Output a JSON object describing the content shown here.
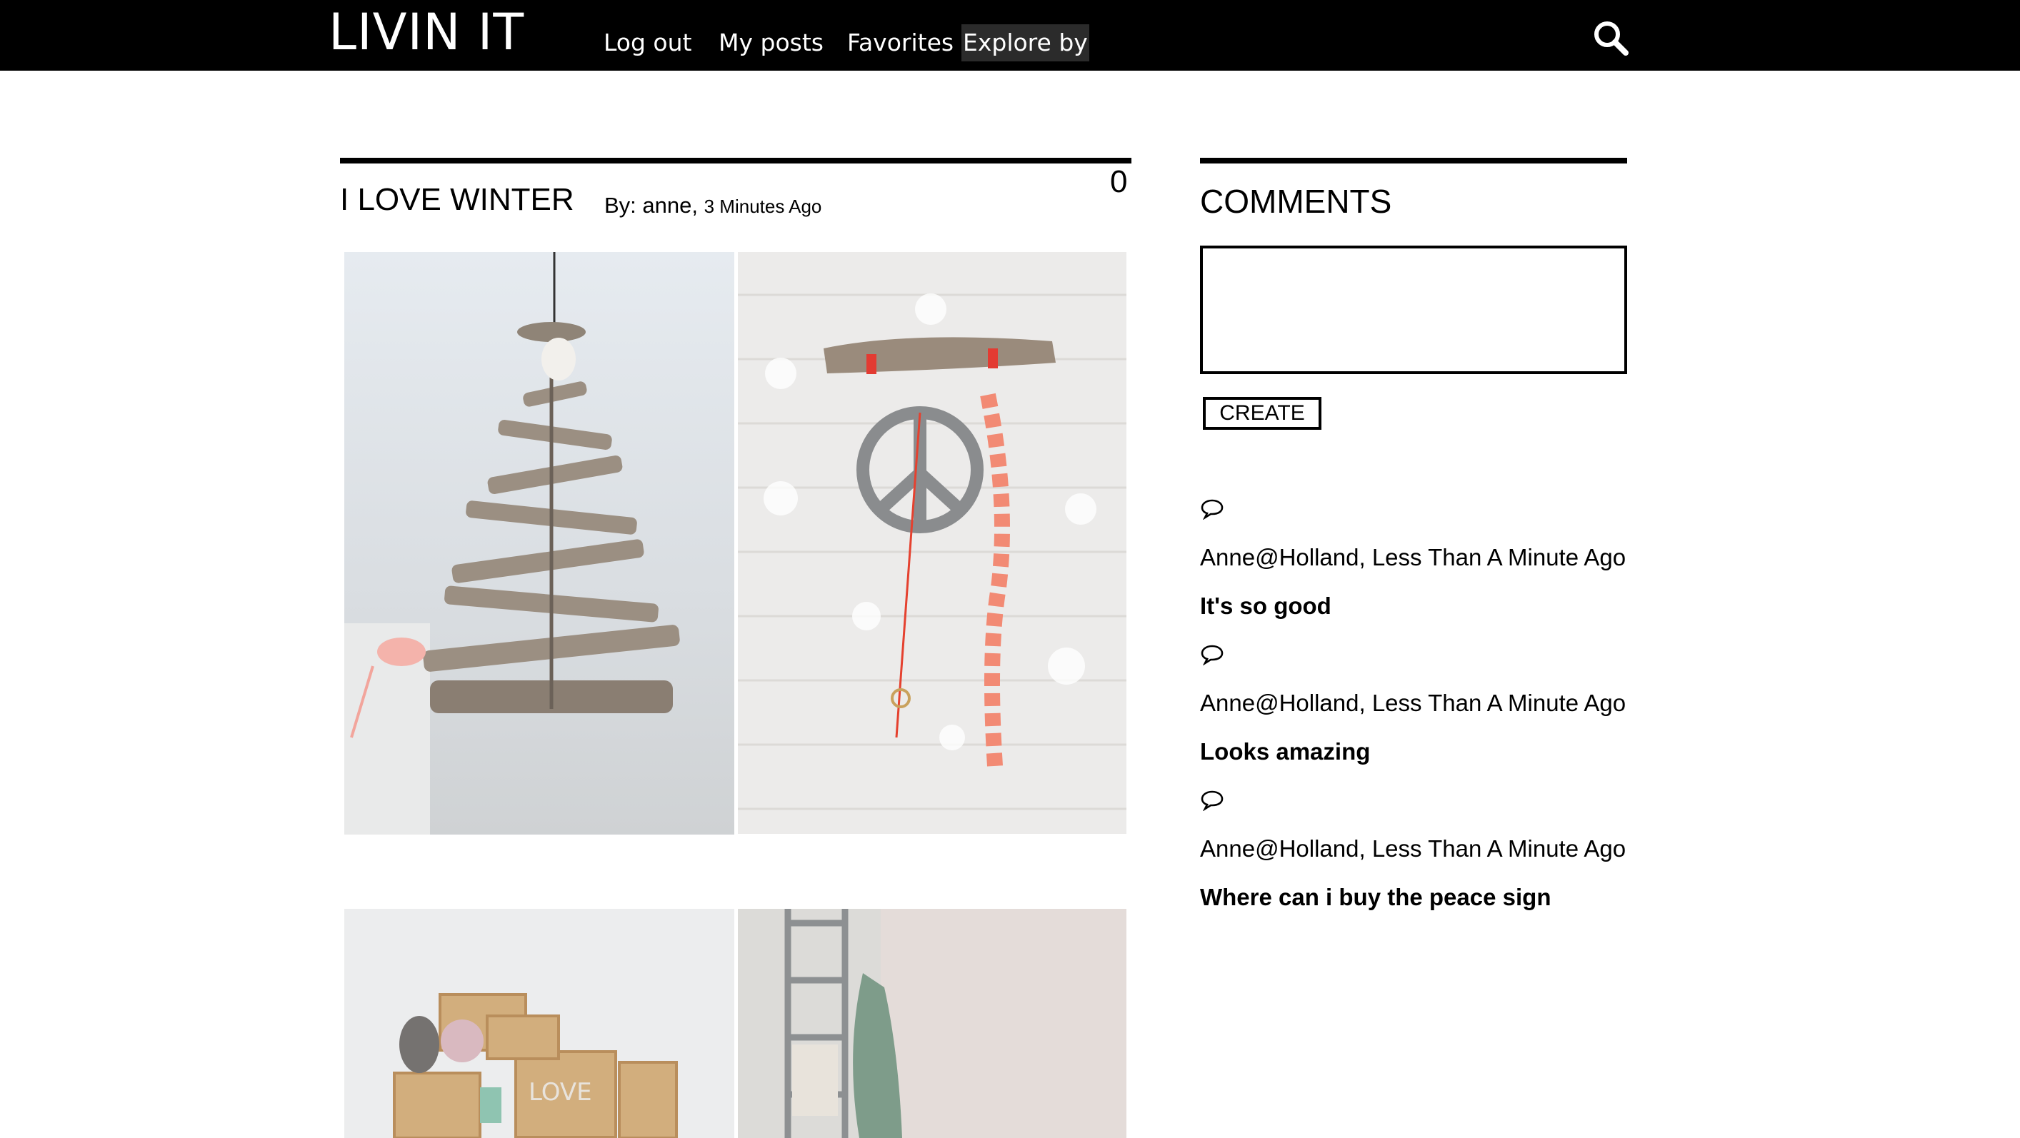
{
  "app": {
    "logo": "LIVIN IT"
  },
  "nav": {
    "items": [
      {
        "label": "Log out"
      },
      {
        "label": "My posts"
      },
      {
        "label": "Favorites"
      },
      {
        "label": "Explore by",
        "active": true
      }
    ]
  },
  "header": {
    "search_icon": "search-icon"
  },
  "post": {
    "title": "I LOVE WINTER",
    "by_label": "By: anne,",
    "time_ago": "3 Minutes Ago",
    "count": "0"
  },
  "comments": {
    "title": "COMMENTS",
    "input_value": "",
    "create_label": "CREATE",
    "items": [
      {
        "icon": "speech-bubble-icon",
        "meta": "Anne@Holland, Less Than A Minute Ago",
        "text": "It's so good"
      },
      {
        "icon": "speech-bubble-icon",
        "meta": "Anne@Holland, Less Than A Minute Ago",
        "text": "Looks amazing"
      },
      {
        "icon": "speech-bubble-icon",
        "meta": "Anne@Holland, Less Than A Minute Ago",
        "text": "Where can i buy the peace sign"
      }
    ]
  },
  "colors": {
    "topbar": "#000000",
    "text": "#000000",
    "background": "#ffffff"
  }
}
